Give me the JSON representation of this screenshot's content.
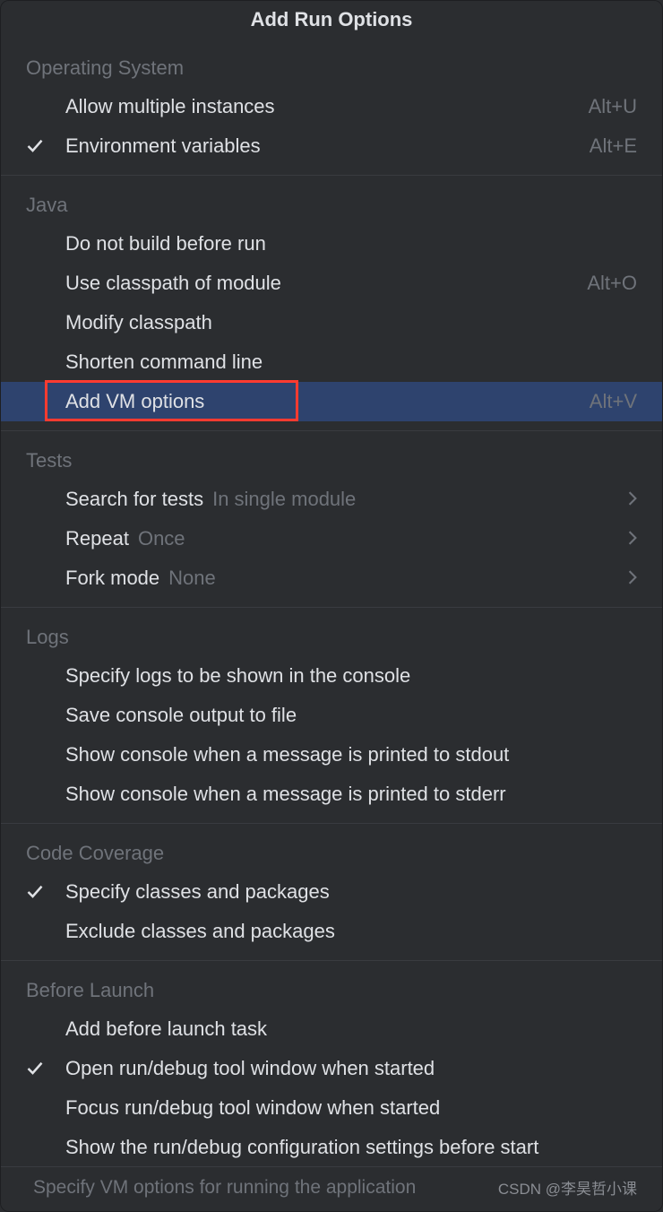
{
  "title": "Add Run Options",
  "sections": {
    "os": {
      "header": "Operating System",
      "items": [
        {
          "label": "Allow multiple instances",
          "shortcut": "Alt+U",
          "checked": false
        },
        {
          "label": "Environment variables",
          "shortcut": "Alt+E",
          "checked": true
        }
      ]
    },
    "java": {
      "header": "Java",
      "items": [
        {
          "label": "Do not build before run",
          "checked": false
        },
        {
          "label": "Use classpath of module",
          "shortcut": "Alt+O",
          "checked": false
        },
        {
          "label": "Modify classpath",
          "checked": false
        },
        {
          "label": "Shorten command line",
          "checked": false
        },
        {
          "label": "Add VM options",
          "shortcut": "Alt+V",
          "checked": false,
          "selected": true,
          "highlighted": true
        }
      ]
    },
    "tests": {
      "header": "Tests",
      "items": [
        {
          "label": "Search for tests",
          "hint": "In single module",
          "submenu": true
        },
        {
          "label": "Repeat",
          "hint": "Once",
          "submenu": true
        },
        {
          "label": "Fork mode",
          "hint": "None",
          "submenu": true
        }
      ]
    },
    "logs": {
      "header": "Logs",
      "items": [
        {
          "label": "Specify logs to be shown in the console"
        },
        {
          "label": "Save console output to file"
        },
        {
          "label": "Show console when a message is printed to stdout"
        },
        {
          "label": "Show console when a message is printed to stderr"
        }
      ]
    },
    "coverage": {
      "header": "Code Coverage",
      "items": [
        {
          "label": "Specify classes and packages",
          "checked": true
        },
        {
          "label": "Exclude classes and packages"
        }
      ]
    },
    "before": {
      "header": "Before Launch",
      "items": [
        {
          "label": "Add before launch task"
        },
        {
          "label": "Open run/debug tool window when started",
          "checked": true
        },
        {
          "label": "Focus run/debug tool window when started"
        },
        {
          "label": "Show the run/debug configuration settings before start"
        }
      ]
    }
  },
  "footer_text": "Specify VM options for running the application",
  "watermark": "CSDN @李昊哲小课"
}
